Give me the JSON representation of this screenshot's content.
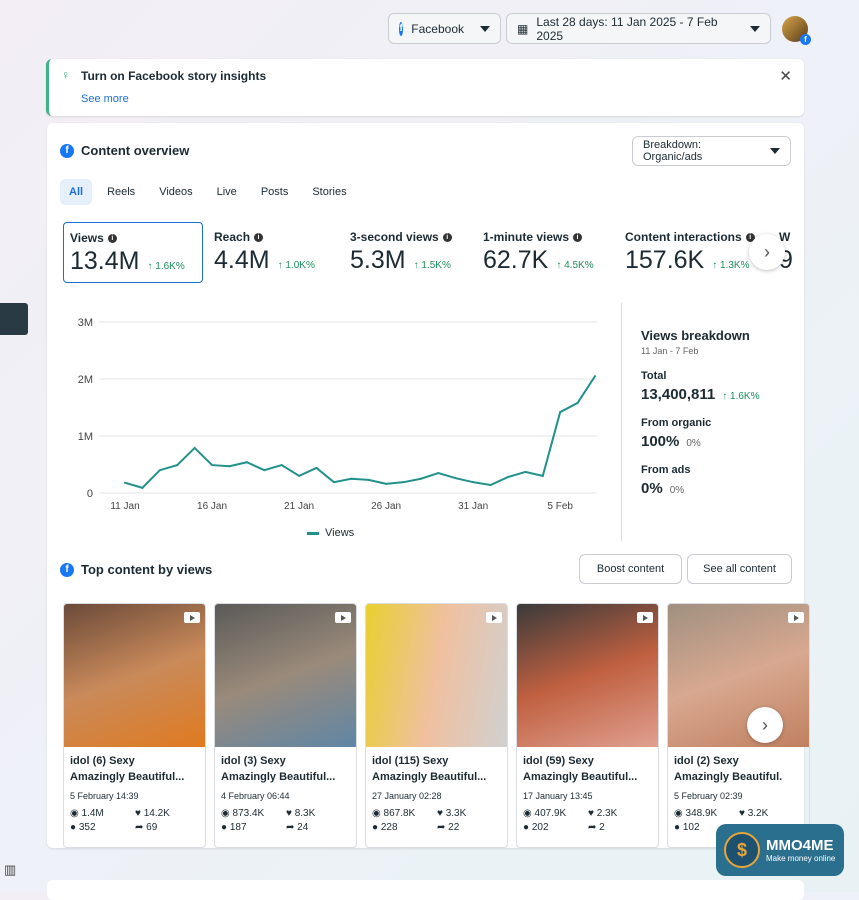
{
  "header": {
    "platform": "Facebook",
    "date_range": "Last 28 days: 11 Jan 2025 - 7 Feb 2025"
  },
  "notice": {
    "title": "Turn on Facebook story insights",
    "link": "See more"
  },
  "overview": {
    "title": "Content overview",
    "breakdown": "Breakdown: Organic/ads",
    "tabs": [
      "All",
      "Reels",
      "Videos",
      "Live",
      "Posts",
      "Stories"
    ],
    "metrics": [
      {
        "label": "Views",
        "value": "13.4M",
        "delta": "↑ 1.6K%"
      },
      {
        "label": "Reach",
        "value": "4.4M",
        "delta": "↑ 1.0K%"
      },
      {
        "label": "3-second views",
        "value": "5.3M",
        "delta": "↑ 1.5K%"
      },
      {
        "label": "1-minute views",
        "value": "62.7K",
        "delta": "↑ 4.5K%"
      },
      {
        "label": "Content interactions",
        "value": "157.6K",
        "delta": "↑ 1.3K%"
      },
      {
        "label": "W",
        "value": "9",
        "delta": ""
      }
    ]
  },
  "chart_data": {
    "type": "line",
    "legend": "Views",
    "legend_position": "bottom",
    "ylim": [
      0,
      3000000
    ],
    "yticks": [
      "0",
      "1M",
      "2M",
      "3M"
    ],
    "xticks": [
      "11 Jan",
      "16 Jan",
      "21 Jan",
      "26 Jan",
      "31 Jan",
      "5 Feb"
    ],
    "x": [
      "11 Jan",
      "12 Jan",
      "13 Jan",
      "14 Jan",
      "15 Jan",
      "16 Jan",
      "17 Jan",
      "18 Jan",
      "19 Jan",
      "20 Jan",
      "21 Jan",
      "22 Jan",
      "23 Jan",
      "24 Jan",
      "25 Jan",
      "26 Jan",
      "27 Jan",
      "28 Jan",
      "29 Jan",
      "30 Jan",
      "31 Jan",
      "1 Feb",
      "2 Feb",
      "3 Feb",
      "4 Feb",
      "5 Feb",
      "6 Feb",
      "7 Feb"
    ],
    "series": [
      {
        "name": "Views",
        "color": "#23918b",
        "values": [
          180000,
          90000,
          400000,
          490000,
          790000,
          490000,
          470000,
          540000,
          400000,
          490000,
          300000,
          440000,
          190000,
          250000,
          230000,
          160000,
          190000,
          250000,
          350000,
          260000,
          190000,
          140000,
          280000,
          370000,
          300000,
          1420000,
          1580000,
          2050000
        ]
      }
    ]
  },
  "breakdown_panel": {
    "title": "Views breakdown",
    "period": "11 Jan - 7 Feb",
    "total_label": "Total",
    "total": "13,400,811",
    "total_delta": "↑ 1.6K%",
    "organic_label": "From organic",
    "organic": "100%",
    "organic_delta": "0%",
    "ads_label": "From ads",
    "ads": "0%",
    "ads_delta": "0%"
  },
  "top": {
    "title": "Top content by views",
    "boost": "Boost content",
    "see_all": "See all content",
    "posts": [
      {
        "title1": "idol (6) Sexy",
        "title2": "Amazingly Beautiful...",
        "date": "5 February 14:39",
        "views": "1.4M",
        "reactions": "14.2K",
        "comments": "352",
        "shares": "69"
      },
      {
        "title1": "idol (3) Sexy",
        "title2": "Amazingly Beautiful...",
        "date": "4 February 06:44",
        "views": "873.4K",
        "reactions": "8.3K",
        "comments": "187",
        "shares": "24"
      },
      {
        "title1": "idol (115) Sexy",
        "title2": "Amazingly Beautiful...",
        "date": "27 January 02:28",
        "views": "867.8K",
        "reactions": "3.3K",
        "comments": "228",
        "shares": "22"
      },
      {
        "title1": "idol (59) Sexy",
        "title2": "Amazingly Beautiful...",
        "date": "17 January 13:45",
        "views": "407.9K",
        "reactions": "2.3K",
        "comments": "202",
        "shares": "2"
      },
      {
        "title1": "idol (2) Sexy",
        "title2": "Amazingly Beautiful.",
        "date": "5 February 02:39",
        "views": "348.9K",
        "reactions": "3.2K",
        "comments": "102",
        "shares": ""
      }
    ]
  },
  "watermark": {
    "name": "MMO4ME",
    "tagline": "Make money online"
  }
}
